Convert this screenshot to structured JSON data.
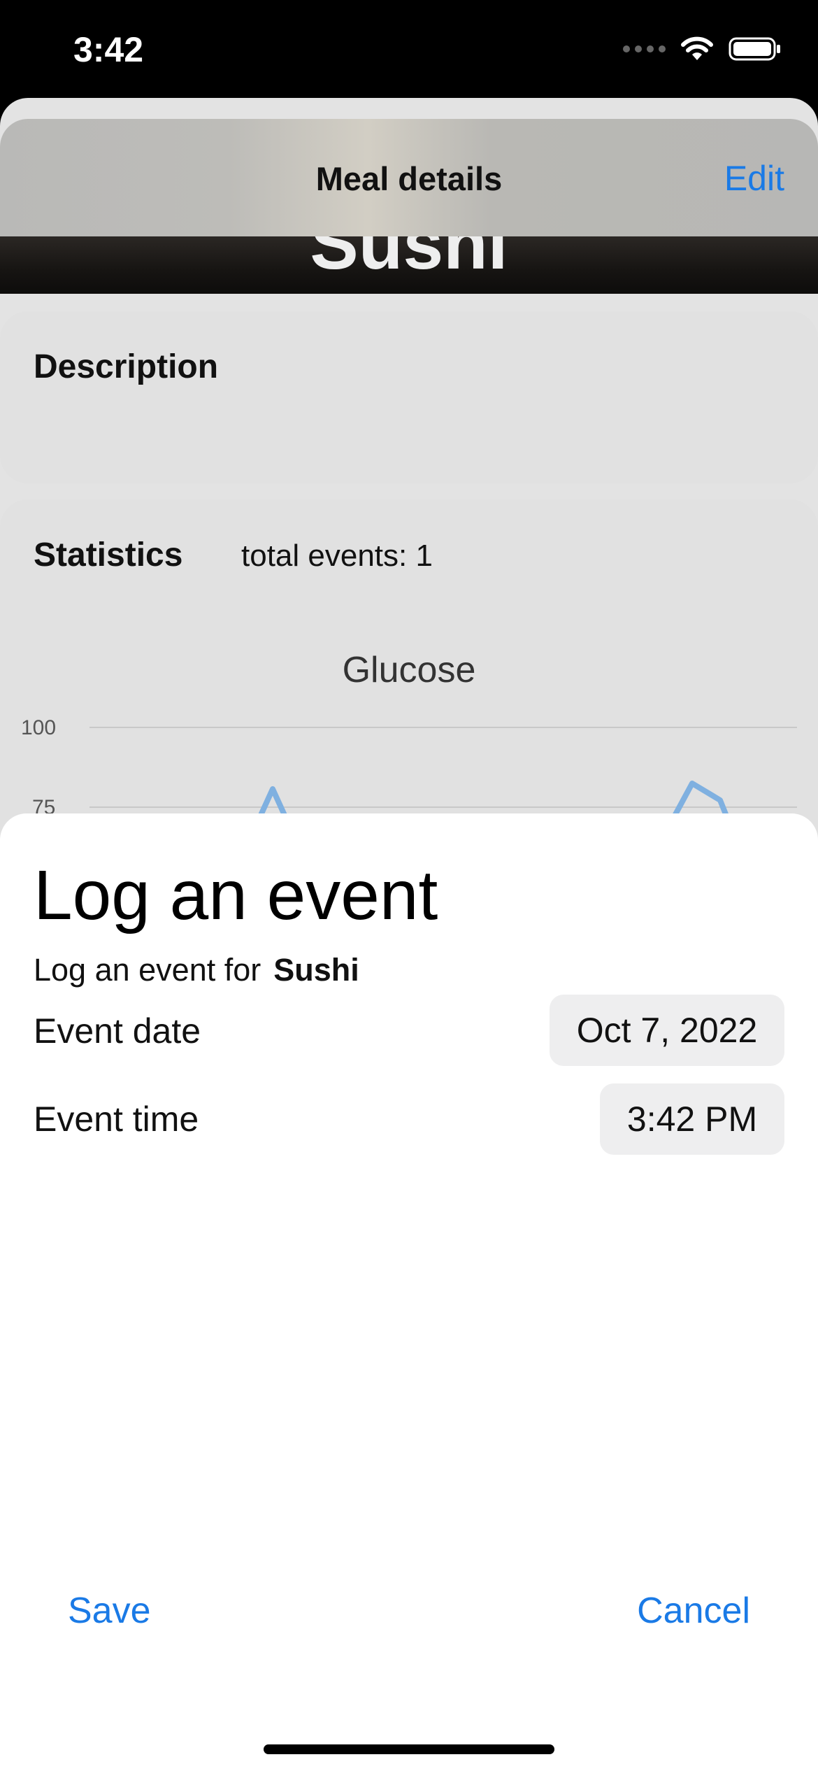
{
  "status_bar": {
    "time": "3:42"
  },
  "nav": {
    "title": "Meal details",
    "edit_label": "Edit"
  },
  "meal": {
    "name": "Sushi"
  },
  "description": {
    "label": "Description"
  },
  "statistics": {
    "label": "Statistics",
    "total_events": "total events: 1",
    "chart_title": "Glucose",
    "y_ticks": [
      "100",
      "75"
    ]
  },
  "sheet": {
    "title": "Log an event",
    "subtitle_prefix": "Log an event for",
    "subtitle_meal": "Sushi",
    "event_date_label": "Event date",
    "event_date_value": "Oct 7, 2022",
    "event_time_label": "Event time",
    "event_time_value": "3:42 PM",
    "save_label": "Save",
    "cancel_label": "Cancel"
  },
  "colors": {
    "accent": "#1a7ae6",
    "chart_line": "#7fb0e0"
  },
  "icons": [
    "signal-dots-icon",
    "wifi-icon",
    "battery-icon"
  ]
}
